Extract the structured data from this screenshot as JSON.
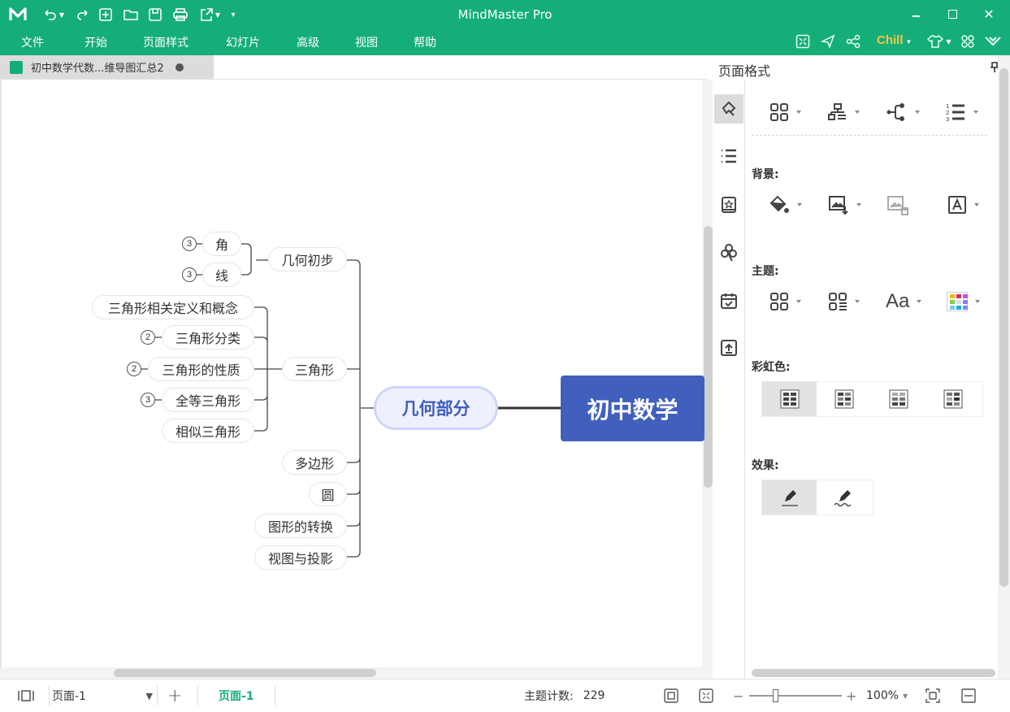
{
  "app": {
    "title": "MindMaster Pro"
  },
  "menu": [
    "文件",
    "开始",
    "页面样式",
    "幻灯片",
    "高级",
    "视图",
    "帮助"
  ],
  "toolbar": {
    "theme_label": "Chill"
  },
  "document_tab": {
    "label": "初中数学代数...维导图汇总2"
  },
  "mindmap": {
    "root": "初中数学",
    "main_topic": "几何部分",
    "branches": [
      {
        "label": "几何初步",
        "children": [
          {
            "label": "角",
            "count": "3"
          },
          {
            "label": "线",
            "count": "3"
          }
        ]
      },
      {
        "label": "三角形",
        "children": [
          {
            "label": "三角形相关定义和概念",
            "count": ""
          },
          {
            "label": "三角形分类",
            "count": "2"
          },
          {
            "label": "三角形的性质",
            "count": "2"
          },
          {
            "label": "全等三角形",
            "count": "3"
          },
          {
            "label": "相似三角形",
            "count": ""
          }
        ]
      },
      {
        "label": "多边形"
      },
      {
        "label": "圆"
      },
      {
        "label": "图形的转换"
      },
      {
        "label": "视图与投影"
      }
    ]
  },
  "panel": {
    "title": "页面格式",
    "sections": {
      "background": "背景:",
      "theme": "主题:",
      "rainbow": "彩虹色:",
      "effect": "效果:"
    },
    "theme_color_swatch": [
      "#f2b705",
      "#e0245e",
      "#c94fd6",
      "#7fcf4a",
      "#dddddd",
      "#8f79f0",
      "#7ccbe0",
      "#1ab0e8",
      "#7a8cf5"
    ]
  },
  "status": {
    "page_select": "页面-1",
    "page_tab": "页面-1",
    "topic_count_label": "主题计数:",
    "topic_count": "229",
    "zoom": "100%",
    "zoom_fraction": 0.25
  },
  "colors": {
    "brand": "#15ae78",
    "root_fill": "#4160be",
    "main_fill": "#eef1fd",
    "main_text": "#3f5cbf",
    "theme_accent": "#f7c744"
  }
}
